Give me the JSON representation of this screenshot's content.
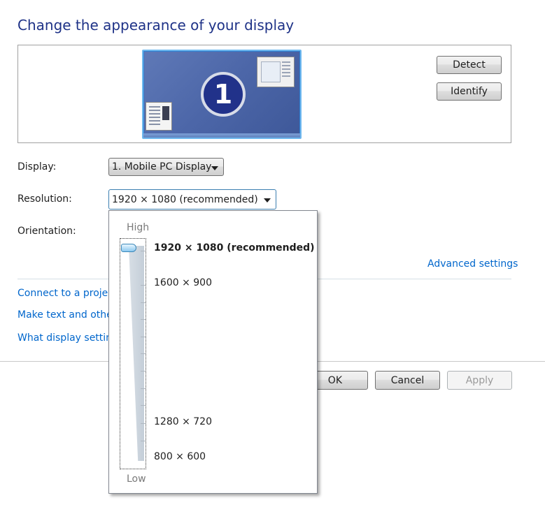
{
  "title": "Change the appearance of your display",
  "preview": {
    "monitor_number": "1",
    "detect_label": "Detect",
    "identify_label": "Identify"
  },
  "fields": {
    "display_label": "Display:",
    "display_value": "1. Mobile PC Display",
    "resolution_label": "Resolution:",
    "resolution_value": "1920 × 1080 (recommended)",
    "orientation_label": "Orientation:"
  },
  "advanced_settings": "Advanced settings",
  "links": {
    "connect_projector": "Connect to a projec",
    "make_text": "Make text and other",
    "what_display": "What display setting"
  },
  "buttons": {
    "ok": "OK",
    "cancel": "Cancel",
    "apply": "Apply"
  },
  "resolution_dropdown": {
    "high_label": "High",
    "low_label": "Low",
    "options": [
      {
        "label": "1920 × 1080 (recommended)",
        "selected": true
      },
      {
        "label": "1600 × 900",
        "selected": false
      },
      {
        "label": "1280 × 720",
        "selected": false
      },
      {
        "label": "800 × 600",
        "selected": false
      }
    ]
  },
  "colors": {
    "title": "#1e3287",
    "link": "#0066cc"
  }
}
